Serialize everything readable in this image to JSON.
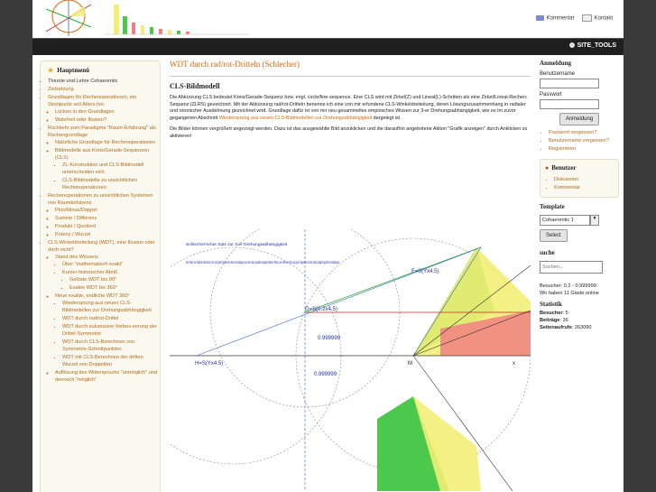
{
  "header": {
    "links": [
      {
        "label": "Kommentar",
        "icon": "comment-icon"
      },
      {
        "label": "Kontakt",
        "icon": "mail-icon"
      }
    ]
  },
  "navbar": {
    "site_tools": "SITE_TOOLS"
  },
  "sidebar": {
    "title": "Hauptmenü",
    "items": [
      {
        "text": "Theorie und Lehre Cohaerentic",
        "level": 1,
        "style": "dark"
      },
      {
        "text": "Zielsetzung",
        "level": 1,
        "style": "link"
      },
      {
        "text": "Grundlagen für Rechenoperationen, ein Streitpunkt seit Alters her.",
        "level": 1,
        "style": "link"
      },
      {
        "text": "Lücken in den Grundlagen",
        "level": 2,
        "style": "link"
      },
      {
        "text": "Wahrheit oder Illusion?",
        "level": 2,
        "style": "link"
      },
      {
        "text": "Rückkehr zum Paradigma \"Raum-Erfahrung\" als Rechengrundlage",
        "level": 1,
        "style": "link"
      },
      {
        "text": "Natürliche Grundlage für Rechenoperationen",
        "level": 2,
        "style": "link"
      },
      {
        "text": "Bildmodelle aus Kreis/Gerade-Sequenzen (CLS)",
        "level": 2,
        "style": "link"
      },
      {
        "text": "ZL-Konstruktion und CLS-Bildmodell unterscheiden sich",
        "level": 3,
        "style": "link"
      },
      {
        "text": "CLS-Bildmodelle zu unsichtlichen Rechenoperationen",
        "level": 3,
        "style": "link"
      },
      {
        "text": "Rechenoperationen zu unsichtlichen Systemen von Raumkohärenz",
        "level": 1,
        "style": "link"
      },
      {
        "text": "Plus/Minus/Doppel",
        "level": 2,
        "style": "link"
      },
      {
        "text": "Summe / Differenz",
        "level": 2,
        "style": "link"
      },
      {
        "text": "Produkt / Quotient",
        "level": 2,
        "style": "link"
      },
      {
        "text": "Potenz / Wurzel",
        "level": 2,
        "style": "link"
      },
      {
        "text": "CLS-Winkeldreiteilung (WDT), eine Illusion oder doch nicht?",
        "level": 1,
        "style": "link"
      },
      {
        "text": "Stand des Wissens",
        "level": 2,
        "style": "link"
      },
      {
        "text": "Über \"mathematisch exakt\"",
        "level": 3,
        "style": "link"
      },
      {
        "text": "Kurzer historischer Abriß",
        "level": 3,
        "style": "link"
      },
      {
        "text": "Gelöste WDT bis 90°",
        "level": 4,
        "style": "link"
      },
      {
        "text": "Exakte WDT bis 360°",
        "level": 4,
        "style": "link"
      },
      {
        "text": "Neue exakte, endliche WDT 360°",
        "level": 2,
        "style": "link"
      },
      {
        "text": "Wiedersprung aus neuen CLS-Bildmodellen zur Drehungsabhängigkeit",
        "level": 3,
        "style": "link"
      },
      {
        "text": "WDT durch rad/rot-Drittel",
        "level": 3,
        "style": "link"
      },
      {
        "text": "WDT durch sukzessive Verbes-serung der Drittel-Symmetrie",
        "level": 3,
        "style": "link"
      },
      {
        "text": "WDT durch CLS-Berechnen von Symmetrie-Schnittpunkten",
        "level": 3,
        "style": "link"
      },
      {
        "text": "WDT mit CLS-Berechnen der dritten Wurzel von Doppelten",
        "level": 3,
        "style": "link"
      },
      {
        "text": "Auflösung des Widerspruchs \"unmöglich\" und dennoch \"möglich\"",
        "level": 2,
        "style": "link"
      }
    ]
  },
  "main": {
    "page_title": "WDT durch rad/rot-Dritteln (Schlecher)",
    "heading": "CLS-Bildmodell",
    "para1": "Die Abkürzung CLS bedeutet Kreis/Gerade-Sequenz bzw. engl. circle/line-sequence. Eine CLS wird mit Zirkel(Z) und Lineal(L)-Schritten als eine Zirkel/Lineal-Rechen-Sequenz (ZLRS) gezeichnet. Mit der Abkürzung rad/rot-Dritteln benenne ich eine von mir erfundene CLS-Winkeldreiteilung, deren Lösungszusammenhang in radialer und rotorischer Ausdehnung gezeichnet wird. Grundlage dafür ist von mir neu gesammeltes empirisches Wissen zur 3-er Drehungsabhängigkeit, wie es im zuvor gegangenen Abschnitt",
    "para1_link": "Wiedersprung aus neuen CLS-Bildmodellen zur Drehungsabhängigkeit",
    "para1_end": "dargelegt ist.",
    "para2": "Die Bilder können vergrößert angezeigt werden. Dazu ist das ausgewählte Bild anzuklicken und die daraufhin angebotene Aktion \"Grafik anzeigen\" durch Anklicken zu aktivieren!",
    "diagram": {
      "note_title": "Schlecher'scher Satz zur 3-er Drehungsabhängigkeit",
      "note_body": "Ein Paar von Radius-Strecken (rot und grün) begrenzt einen Kreisbogen und ein dazu parallel ausgerichtetes Paar von Sehnen (rot und grün) begrenzt einen dazu doppelt großen Kreisbogen",
      "labels": {
        "F": "F=S(Yx4.5)",
        "G": "G=S(0.2x4.5)",
        "H": "H=S(Yx4.5)",
        "M": "M",
        "v1": "0.999999",
        "v2": "0.999999",
        "x": "x"
      }
    }
  },
  "login": {
    "title": "Anmeldung",
    "user_label": "Benutzername",
    "pass_label": "Passwort",
    "button": "Anmeldung",
    "links": [
      "Passwort vergessen?",
      "Benutzername vergessen?",
      "Registrieren"
    ]
  },
  "user_box": {
    "title": "Benutzer",
    "links": [
      "Diskussion",
      "Kommentar"
    ]
  },
  "template": {
    "title": "Template",
    "selected": "Cohaerentic 1",
    "button": "Select"
  },
  "search": {
    "title": "suche",
    "placeholder": "Suchen..."
  },
  "stats": {
    "visitors": "Besucher: 0.2 - 0.999999",
    "guests": "Wir haben 11 Gäste online",
    "title": "Statistik",
    "rows": [
      {
        "label": "Besucher",
        "value": "5"
      },
      {
        "label": "Beiträge",
        "value": "36"
      },
      {
        "label": "Seitenaufrufe",
        "value": "263090"
      }
    ]
  },
  "colors": {
    "accent": "#d9670b",
    "link": "#b06a1a",
    "navbar": "#1f1f1f",
    "sidebar_bg": "#fbf9ef",
    "red_fill": "#f08080",
    "green_fill": "#4cc94c",
    "yellow_fill": "#f2ee77"
  }
}
